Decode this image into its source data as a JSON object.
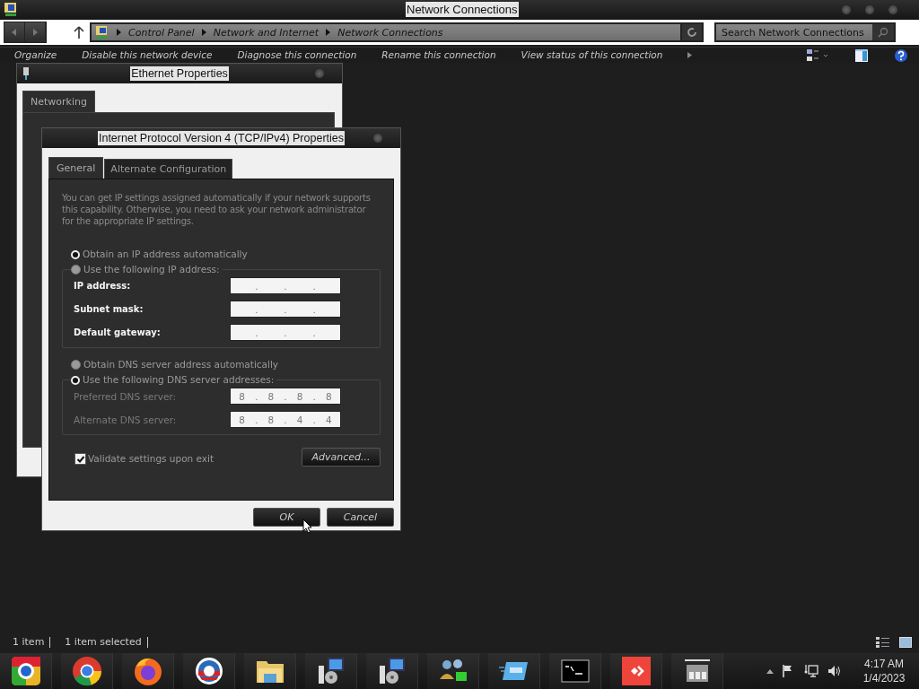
{
  "window": {
    "title": "Network Connections"
  },
  "address_bar": {
    "breadcrumb": [
      "Control Panel",
      "Network and Internet",
      "Network Connections"
    ]
  },
  "search": {
    "placeholder": "Search Network Connections"
  },
  "command_bar": [
    "Organize",
    "Disable this network device",
    "Diagnose this connection",
    "Rename this connection",
    "View status of this connection"
  ],
  "ethernet_dialog": {
    "title": "Ethernet Properties",
    "tabs": [
      {
        "label": "Networking",
        "selected": true
      }
    ]
  },
  "ipv4_dialog": {
    "title": "Internet Protocol Version 4 (TCP/IPv4) Properties",
    "tabs": [
      {
        "label": "General",
        "selected": true
      },
      {
        "label": "Alternate Configuration",
        "selected": false
      }
    ],
    "description": "You can get IP settings assigned automatically if your network supports this capability. Otherwise, you need to ask your network administrator for the appropriate IP settings.",
    "separator": ".",
    "ip_auto": {
      "label": "Obtain an IP address automatically",
      "selected": true
    },
    "ip_manual": {
      "label": "Use the following IP address:",
      "selected": false
    },
    "ip_fields": [
      {
        "label": "IP address:"
      },
      {
        "label": "Subnet mask:"
      },
      {
        "label": "Default gateway:"
      }
    ],
    "dns_auto": {
      "label": "Obtain DNS server address automatically",
      "selected": false
    },
    "dns_manual": {
      "label": "Use the following DNS server addresses:",
      "selected": true
    },
    "dns_fields": [
      {
        "label": "Preferred DNS server:",
        "octets": [
          "8",
          "8",
          "8",
          "8"
        ]
      },
      {
        "label": "Alternate DNS server:",
        "octets": [
          "8",
          "8",
          "4",
          "4"
        ]
      }
    ],
    "validate": {
      "label": "Validate settings upon exit",
      "checked": true
    },
    "advanced_button": "Advanced...",
    "buttons": [
      "OK",
      "Cancel"
    ]
  },
  "status_bar": [
    "1 item",
    "1 item selected"
  ],
  "clock": {
    "time": "4:17 AM",
    "date": "1/4/2023"
  }
}
